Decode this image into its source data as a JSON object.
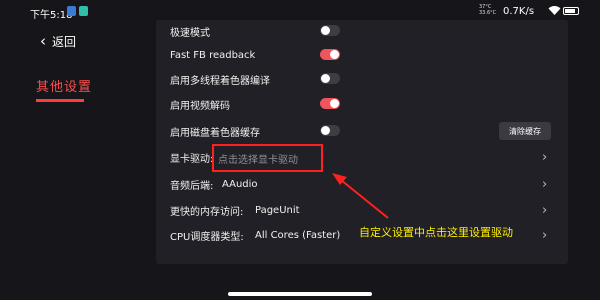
{
  "status_bar": {
    "time": "下午5:18",
    "temp_line1": "37°C",
    "temp_line2": "33.6°C",
    "net_speed": "0.7K/s",
    "battery_level": 0.85
  },
  "nav": {
    "back_label": "返回",
    "active_item": "其他设置"
  },
  "settings": {
    "turbo_mode": {
      "label": "极速模式",
      "enabled": false
    },
    "fast_fb_readback": {
      "label": "Fast FB readback",
      "enabled": true
    },
    "multithread_shader": {
      "label": "启用多线程着色器编译",
      "enabled": false
    },
    "video_decode": {
      "label": "启用视频解码",
      "enabled": true
    },
    "disk_shader_cache": {
      "label": "启用磁盘着色器缓存",
      "enabled": false,
      "clear_button": "清除缓存"
    },
    "gpu_driver": {
      "label": "显卡驱动:",
      "placeholder": "点击选择显卡驱动"
    },
    "audio_backend": {
      "label": "音频后端:",
      "value": "AAudio"
    },
    "fast_memory": {
      "label": "更快的内存访问:",
      "value": "PageUnit"
    },
    "cpu_scheduler": {
      "label": "CPU调度器类型:",
      "value": "All Cores (Faster)"
    }
  },
  "annotation": {
    "text": "自定义设置中点击这里设置驱动",
    "color": "#fff000"
  },
  "colors": {
    "accent": "#ff3b3b",
    "toggle_on": "#f0545c",
    "toggle_off": "#3d3d44"
  }
}
